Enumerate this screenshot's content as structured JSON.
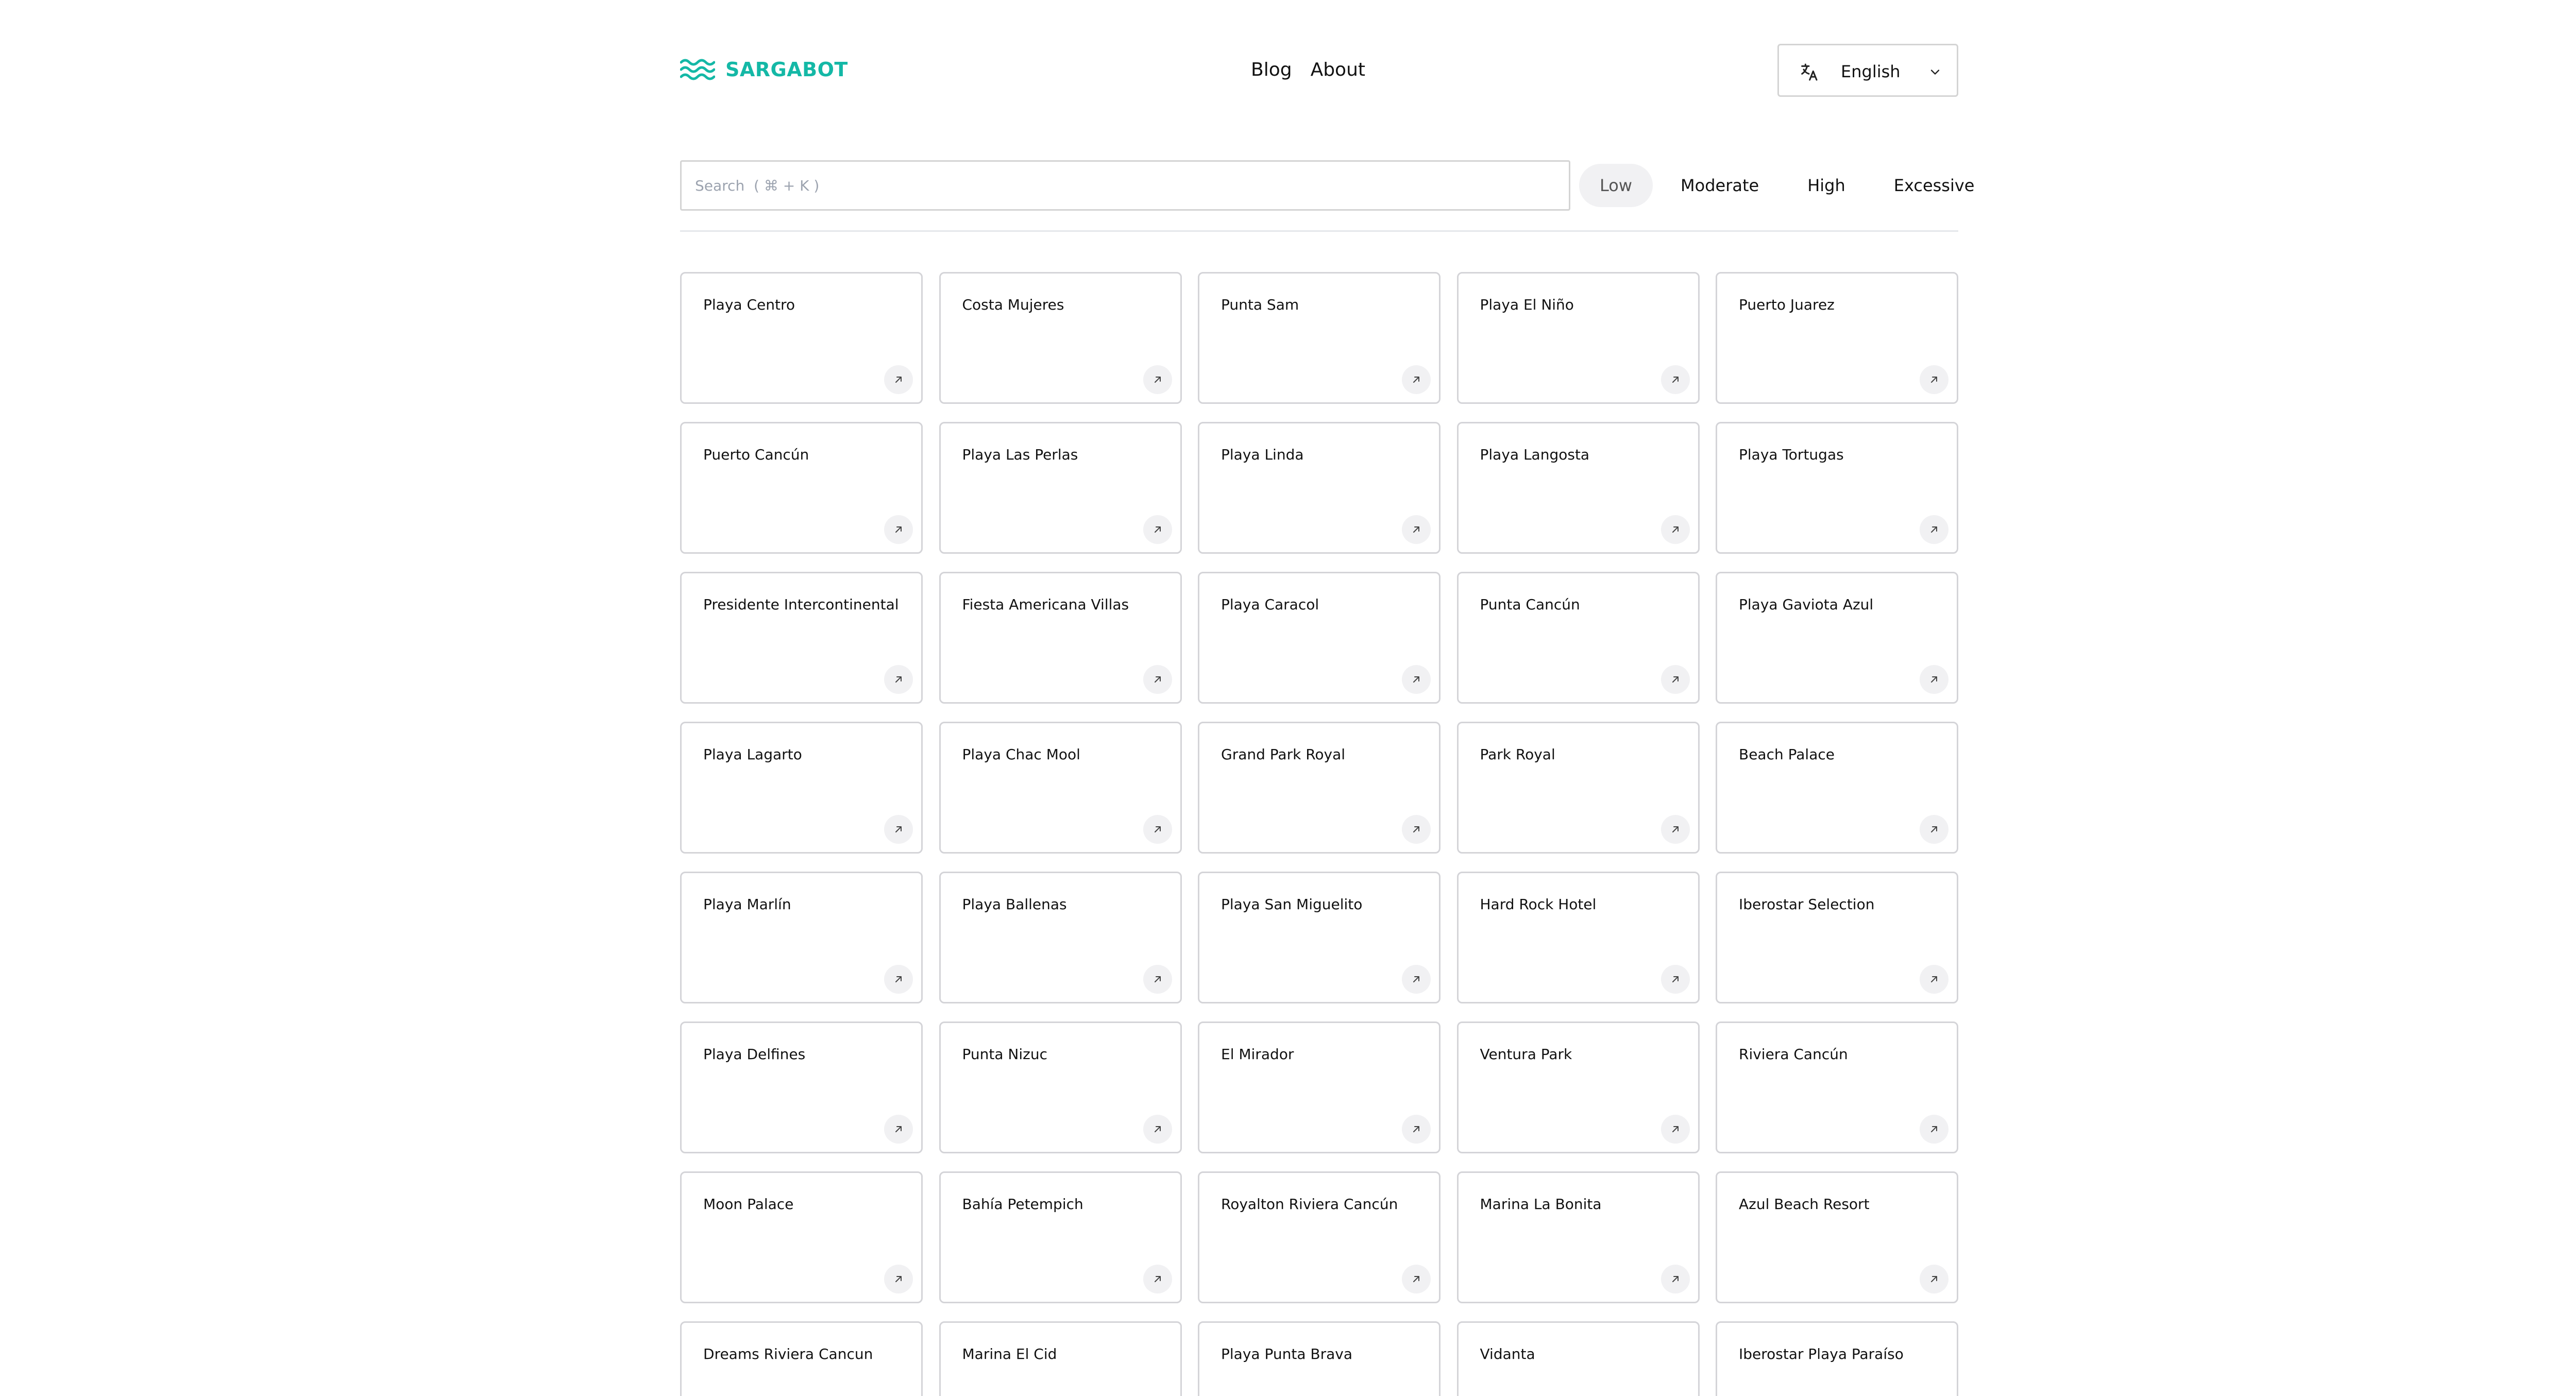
{
  "brand": {
    "name": "SARGABOT",
    "color": "#14b8a6"
  },
  "nav": {
    "blog": "Blog",
    "about": "About"
  },
  "language": {
    "selected": "English"
  },
  "search": {
    "placeholder": "Search  ( ⌘ + K )"
  },
  "levels": {
    "low": "Low",
    "moderate": "Moderate",
    "high": "High",
    "excessive": "Excessive",
    "active": "Low"
  },
  "beaches": [
    "Playa Centro",
    "Costa Mujeres",
    "Punta Sam",
    "Playa El Niño",
    "Puerto Juarez",
    "Puerto Cancún",
    "Playa Las Perlas",
    "Playa Linda",
    "Playa Langosta",
    "Playa Tortugas",
    "Presidente Intercontinental",
    "Fiesta Americana Villas",
    "Playa Caracol",
    "Punta Cancún",
    "Playa Gaviota Azul",
    "Playa Lagarto",
    "Playa Chac Mool",
    "Grand Park Royal",
    "Park Royal",
    "Beach Palace",
    "Playa Marlín",
    "Playa Ballenas",
    "Playa San Miguelito",
    "Hard Rock Hotel",
    "Iberostar Selection",
    "Playa Delfines",
    "Punta Nizuc",
    "El Mirador",
    "Ventura Park",
    "Riviera Cancún",
    "Moon Palace",
    "Bahía Petempich",
    "Royalton Riviera Cancún",
    "Marina La Bonita",
    "Azul Beach Resort",
    "Dreams Riviera Cancun",
    "Marina El Cid",
    "Playa Punta Brava",
    "Vidanta",
    "Iberostar Playa Paraíso"
  ]
}
